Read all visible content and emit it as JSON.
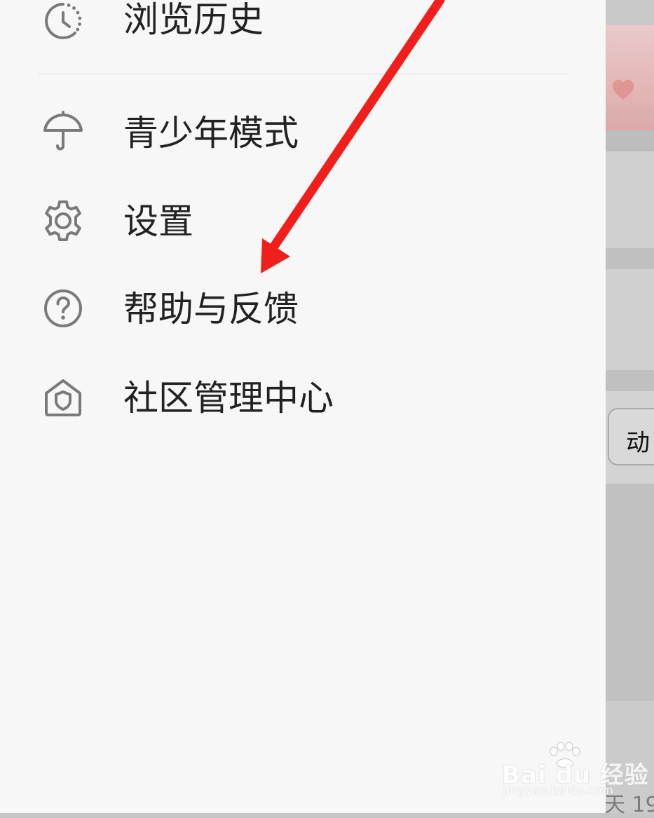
{
  "drawer": {
    "items": [
      {
        "id": "history",
        "label": "浏览历史",
        "icon": "clock-history-icon"
      },
      {
        "id": "teen-mode",
        "label": "青少年模式",
        "icon": "umbrella-icon"
      },
      {
        "id": "settings",
        "label": "设置",
        "icon": "gear-icon"
      },
      {
        "id": "help",
        "label": "帮助与反馈",
        "icon": "question-circle-icon"
      },
      {
        "id": "community",
        "label": "社区管理中心",
        "icon": "shield-house-icon"
      }
    ]
  },
  "background": {
    "pill_text": "动",
    "date_text": "天 19"
  },
  "watermark": {
    "logo_text": "Bai du 经验",
    "url_text": "jingyan.baidu.com"
  },
  "colors": {
    "drawer_bg": "#f7f7f7",
    "icon": "#7a7a7a",
    "text": "#222222",
    "arrow": "#f01f1c"
  }
}
